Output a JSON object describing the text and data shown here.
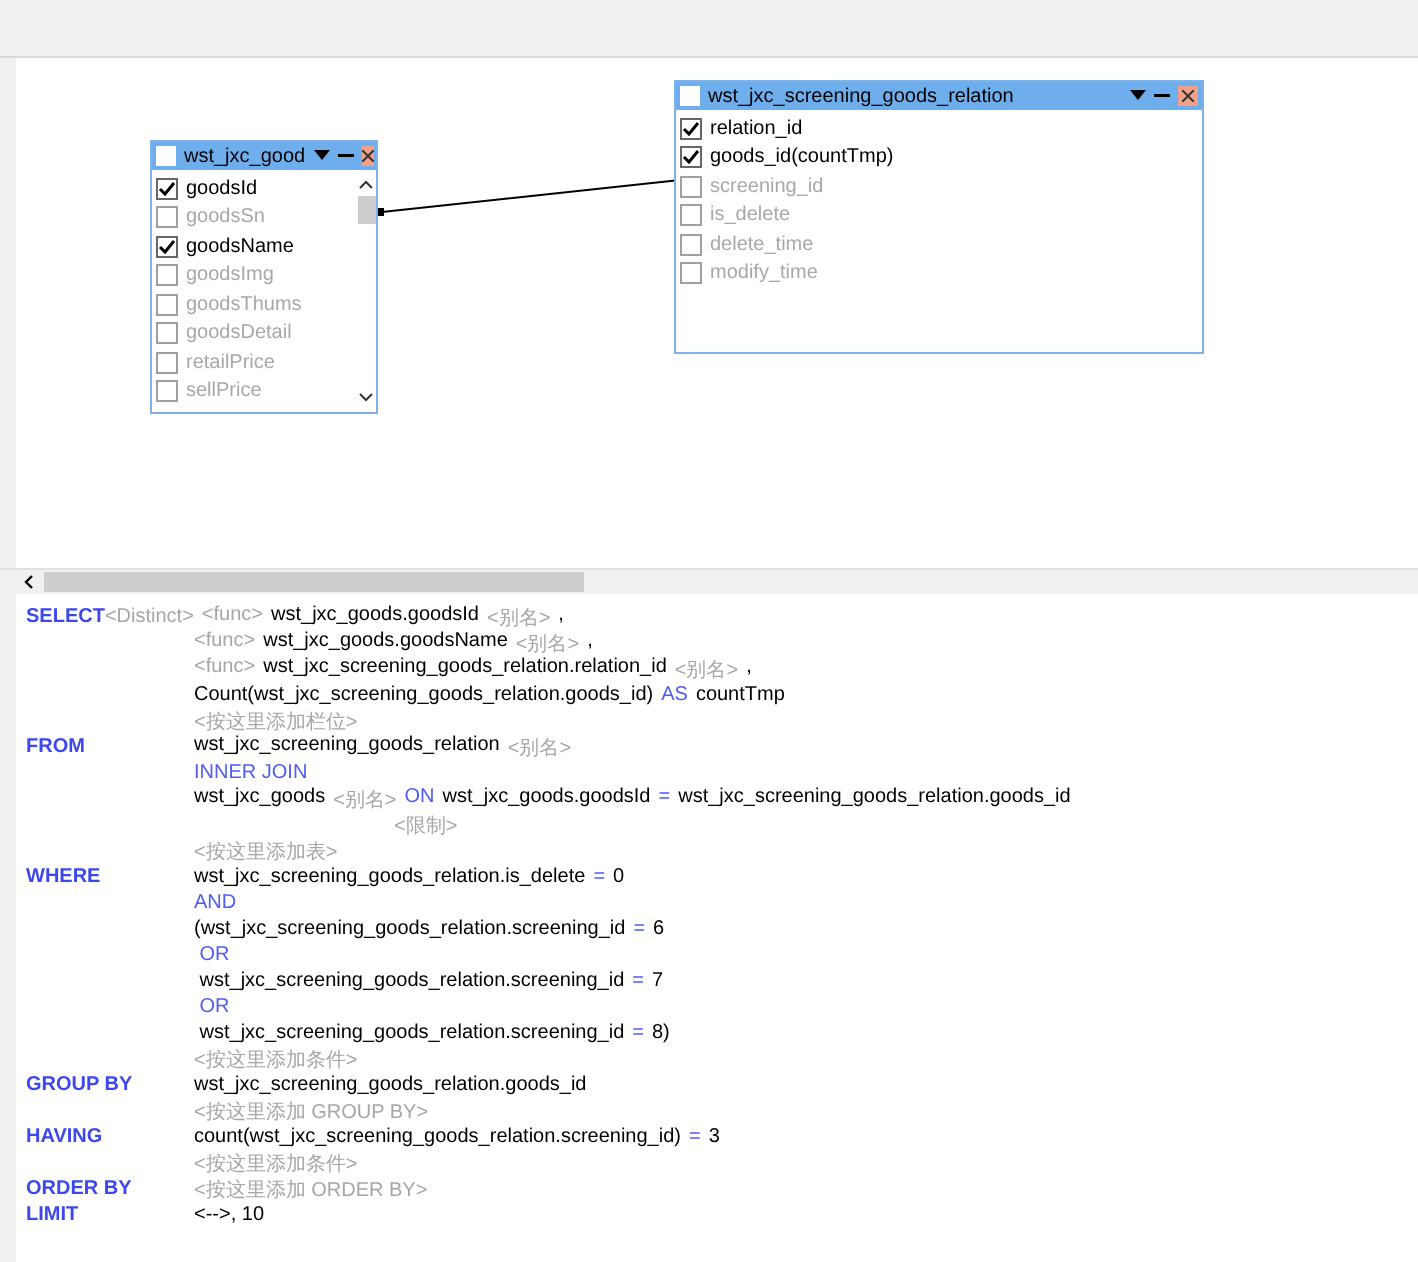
{
  "tables": [
    {
      "title": "wst_jxc_good",
      "kind": "left",
      "all_checked": false,
      "scrollbar": true,
      "columns": [
        {
          "name": "goodsId",
          "checked": true
        },
        {
          "name": "goodsSn",
          "checked": false
        },
        {
          "name": "goodsName",
          "checked": true
        },
        {
          "name": "goodsImg",
          "checked": false
        },
        {
          "name": "goodsThums",
          "checked": false
        },
        {
          "name": "goodsDetail",
          "checked": false
        },
        {
          "name": "retailPrice",
          "checked": false
        },
        {
          "name": "sellPrice",
          "checked": false
        }
      ]
    },
    {
      "title": "wst_jxc_screening_goods_relation",
      "kind": "right",
      "all_checked": false,
      "scrollbar": false,
      "columns": [
        {
          "name": "relation_id",
          "checked": true
        },
        {
          "name": "goods_id(countTmp)",
          "checked": true
        },
        {
          "name": "screening_id",
          "checked": false
        },
        {
          "name": "is_delete",
          "checked": false
        },
        {
          "name": "delete_time",
          "checked": false
        },
        {
          "name": "modify_time",
          "checked": false
        }
      ]
    }
  ],
  "sql": [
    {
      "clause": "SELECT",
      "clause_hint": "<Distinct>",
      "tokens": [
        {
          "kind": "hint",
          "text": "<func>"
        },
        {
          "kind": "text",
          "text": "wst_jxc_goods.goodsId"
        },
        {
          "kind": "hint",
          "text": "<别名>"
        },
        {
          "kind": "text",
          "text": ","
        }
      ]
    },
    {
      "tokens": [
        {
          "kind": "hint",
          "text": "<func>"
        },
        {
          "kind": "text",
          "text": "wst_jxc_goods.goodsName"
        },
        {
          "kind": "hint",
          "text": "<别名>"
        },
        {
          "kind": "text",
          "text": ","
        }
      ]
    },
    {
      "tokens": [
        {
          "kind": "hint",
          "text": "<func>"
        },
        {
          "kind": "text",
          "text": "wst_jxc_screening_goods_relation.relation_id"
        },
        {
          "kind": "hint",
          "text": "<别名>"
        },
        {
          "kind": "text",
          "text": ","
        }
      ]
    },
    {
      "tokens": [
        {
          "kind": "text",
          "text": "Count(wst_jxc_screening_goods_relation.goods_id)"
        },
        {
          "kind": "op",
          "text": "AS"
        },
        {
          "kind": "text",
          "text": "countTmp"
        }
      ]
    },
    {
      "tokens": [
        {
          "kind": "hint",
          "text": "<按这里添加栏位>"
        }
      ]
    },
    {
      "clause": "FROM",
      "tokens": [
        {
          "kind": "text",
          "text": "wst_jxc_screening_goods_relation"
        },
        {
          "kind": "hint",
          "text": "<别名>"
        }
      ]
    },
    {
      "tokens": [
        {
          "kind": "op",
          "text": "INNER JOIN"
        }
      ]
    },
    {
      "tokens": [
        {
          "kind": "text",
          "text": "wst_jxc_goods"
        },
        {
          "kind": "hint",
          "text": "<别名>"
        },
        {
          "kind": "op",
          "text": "ON"
        },
        {
          "kind": "text",
          "text": "wst_jxc_goods.goodsId"
        },
        {
          "kind": "op",
          "text": "="
        },
        {
          "kind": "text",
          "text": "wst_jxc_screening_goods_relation.goods_id"
        }
      ]
    },
    {
      "kind": "sub",
      "tokens": [
        {
          "kind": "hint",
          "text": "<限制>"
        }
      ]
    },
    {
      "tokens": [
        {
          "kind": "hint",
          "text": "<按这里添加表>"
        }
      ]
    },
    {
      "clause": "WHERE",
      "tokens": [
        {
          "kind": "text",
          "text": "wst_jxc_screening_goods_relation.is_delete"
        },
        {
          "kind": "op",
          "text": "="
        },
        {
          "kind": "text",
          "text": "0"
        }
      ]
    },
    {
      "tokens": [
        {
          "kind": "op",
          "text": "AND"
        }
      ]
    },
    {
      "tokens": [
        {
          "kind": "text",
          "text": "(wst_jxc_screening_goods_relation.screening_id"
        },
        {
          "kind": "op",
          "text": "="
        },
        {
          "kind": "text",
          "text": "6"
        }
      ]
    },
    {
      "tokens": [
        {
          "kind": "op",
          "text": " OR"
        }
      ]
    },
    {
      "tokens": [
        {
          "kind": "text",
          "text": " wst_jxc_screening_goods_relation.screening_id"
        },
        {
          "kind": "op",
          "text": "="
        },
        {
          "kind": "text",
          "text": "7"
        }
      ]
    },
    {
      "tokens": [
        {
          "kind": "op",
          "text": " OR"
        }
      ]
    },
    {
      "tokens": [
        {
          "kind": "text",
          "text": " wst_jxc_screening_goods_relation.screening_id"
        },
        {
          "kind": "op",
          "text": "="
        },
        {
          "kind": "text",
          "text": "8)"
        }
      ]
    },
    {
      "tokens": [
        {
          "kind": "hint",
          "text": "<按这里添加条件>"
        }
      ]
    },
    {
      "clause": "GROUP BY",
      "tokens": [
        {
          "kind": "text",
          "text": "wst_jxc_screening_goods_relation.goods_id"
        }
      ]
    },
    {
      "tokens": [
        {
          "kind": "hint",
          "text": "<按这里添加 GROUP BY>"
        }
      ]
    },
    {
      "clause": "HAVING",
      "tokens": [
        {
          "kind": "text",
          "text": "count(wst_jxc_screening_goods_relation.screening_id)"
        },
        {
          "kind": "op",
          "text": "="
        },
        {
          "kind": "text",
          "text": "3"
        }
      ]
    },
    {
      "tokens": [
        {
          "kind": "hint",
          "text": "<按这里添加条件>"
        }
      ]
    },
    {
      "clause": "ORDER BY",
      "tokens": [
        {
          "kind": "hint",
          "text": "<按这里添加 ORDER BY>"
        }
      ]
    },
    {
      "clause": "LIMIT",
      "tokens": [
        {
          "kind": "text",
          "text": "<-->, 10"
        }
      ]
    }
  ]
}
